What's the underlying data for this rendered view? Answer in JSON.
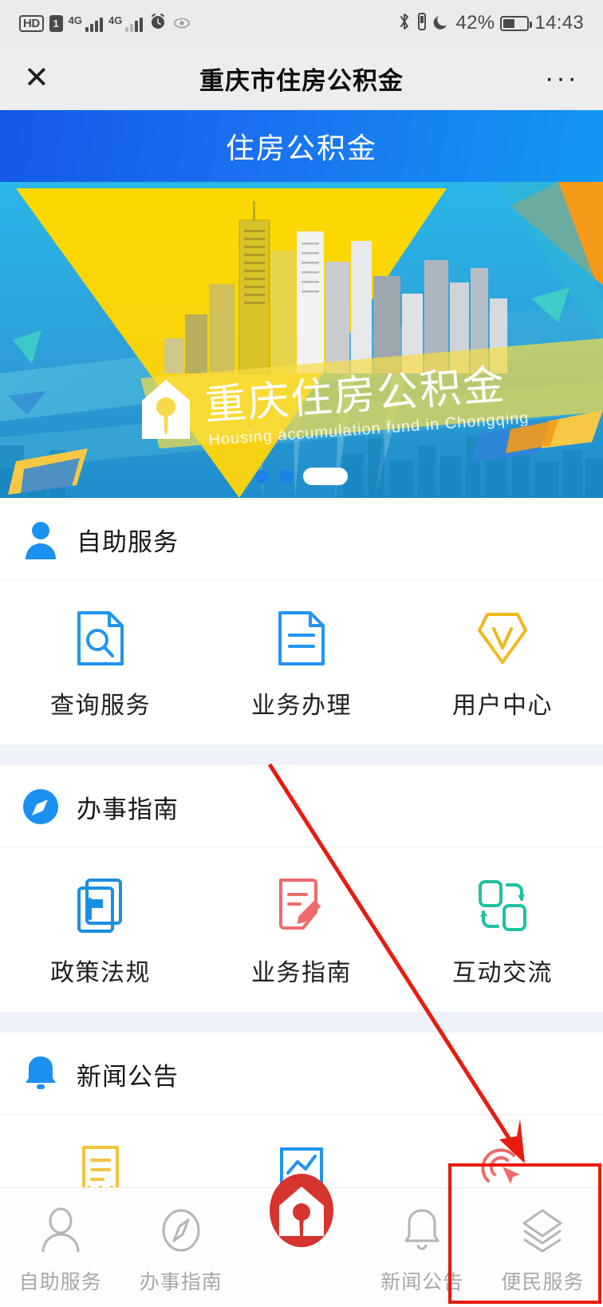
{
  "status_bar": {
    "hd_label": "HD",
    "sim_label": "1",
    "net1": "4G",
    "net2": "4G",
    "alarm_icon": "alarm-clock-icon",
    "eye_icon": "eye-care-icon",
    "bluetooth_icon": "bluetooth-icon",
    "vibrate_icon": "vibrate-icon",
    "moon_icon": "do-not-disturb-moon-icon",
    "battery_percent": "42%",
    "time": "14:43"
  },
  "titlebar": {
    "close_icon": "close-icon",
    "title": "重庆市住房公积金",
    "more_icon": "more-options-icon",
    "more_label": "···"
  },
  "banner": {
    "title": "住房公积金"
  },
  "hero": {
    "headline": "重庆住房公积金",
    "subline": "Housing accumulation fund in Chongqing",
    "logo_icon": "house-keyhole-logo-icon",
    "dots": [
      "dot-1",
      "dot-2",
      "dot-3-active"
    ]
  },
  "sections": [
    {
      "id": "self-service",
      "icon": "person-icon",
      "title": "自助服务",
      "tiles": [
        {
          "icon": "document-search-icon",
          "label": "查询服务",
          "color": "#2196f3"
        },
        {
          "icon": "document-lines-icon",
          "label": "业务办理",
          "color": "#2196f3"
        },
        {
          "icon": "diamond-v-icon",
          "label": "用户中心",
          "color": "#f2b820"
        }
      ]
    },
    {
      "id": "guide",
      "icon": "compass-icon",
      "title": "办事指南",
      "tiles": [
        {
          "icon": "policy-flag-book-icon",
          "label": "政策法规",
          "color": "#1a8fe0"
        },
        {
          "icon": "document-pen-icon",
          "label": "业务指南",
          "color": "#ef6b6b"
        },
        {
          "icon": "exchange-squares-icon",
          "label": "互动交流",
          "color": "#1fc1a0"
        }
      ]
    },
    {
      "id": "news",
      "icon": "bell-icon",
      "title": "新闻公告",
      "tiles": [
        {
          "icon": "receipt-icon",
          "label": "",
          "color": "#f2c33c"
        },
        {
          "icon": "chart-report-icon",
          "label": "",
          "color": "#2196f3"
        },
        {
          "icon": "click-target-icon",
          "label": "",
          "color": "#ef6b6b"
        }
      ]
    }
  ],
  "tabbar": {
    "items": [
      {
        "icon": "person-outline-icon",
        "label": "自助服务",
        "active": false
      },
      {
        "icon": "compass-outline-icon",
        "label": "办事指南",
        "active": false
      },
      {
        "icon": "house-key-logo-icon",
        "label": "",
        "active": false
      },
      {
        "icon": "bell-outline-icon",
        "label": "新闻公告",
        "active": false
      },
      {
        "icon": "layers-stack-icon",
        "label": "便民服务",
        "active": true
      }
    ]
  },
  "annotation": {
    "arrow_color": "#e81b10",
    "highlight_color": "#e81b10",
    "highlight_target": "便民服务"
  }
}
